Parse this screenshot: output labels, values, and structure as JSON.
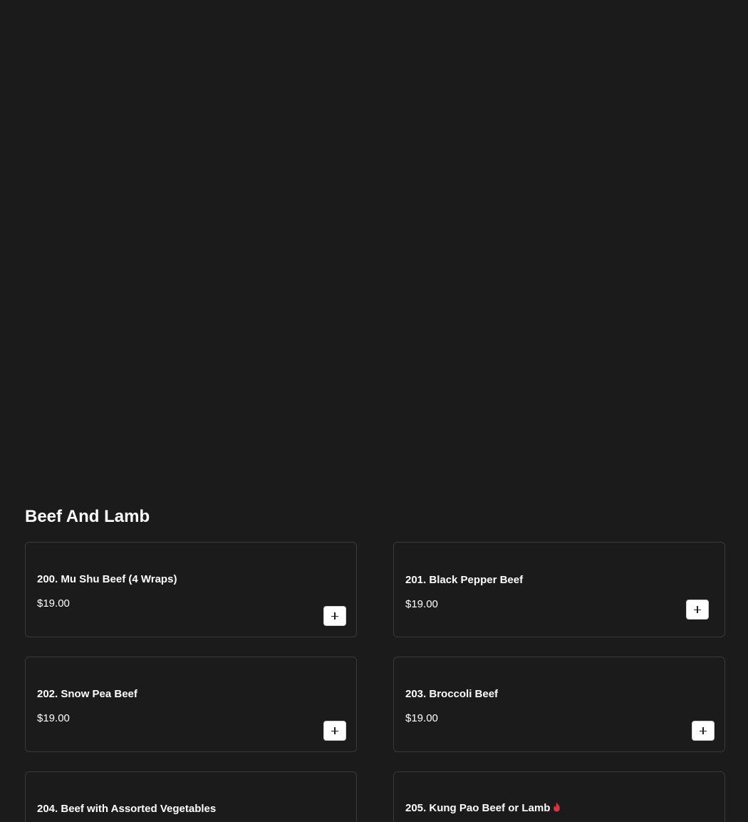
{
  "section": {
    "title": "Beef And Lamb"
  },
  "items": [
    {
      "name": "200. Mu Shu Beef (4 Wraps)",
      "price": "$19.00",
      "spicy": false
    },
    {
      "name": "201. Black Pepper Beef",
      "price": "$19.00",
      "spicy": false
    },
    {
      "name": "202. Snow Pea Beef",
      "price": "$19.00",
      "spicy": false
    },
    {
      "name": "203. Broccoli Beef",
      "price": "$19.00",
      "spicy": false
    },
    {
      "name": "204. Beef with Assorted Vegetables",
      "price": "",
      "spicy": false
    },
    {
      "name": "205. Kung Pao Beef or Lamb",
      "price": "",
      "spicy": true
    }
  ],
  "icons": {
    "add": "plus-icon",
    "spicy": "flame-icon"
  },
  "colors": {
    "background": "#1b1b1b",
    "card_border": "#3a3a3a",
    "spicy": "#e0343c",
    "button_bg": "#ffffff"
  }
}
